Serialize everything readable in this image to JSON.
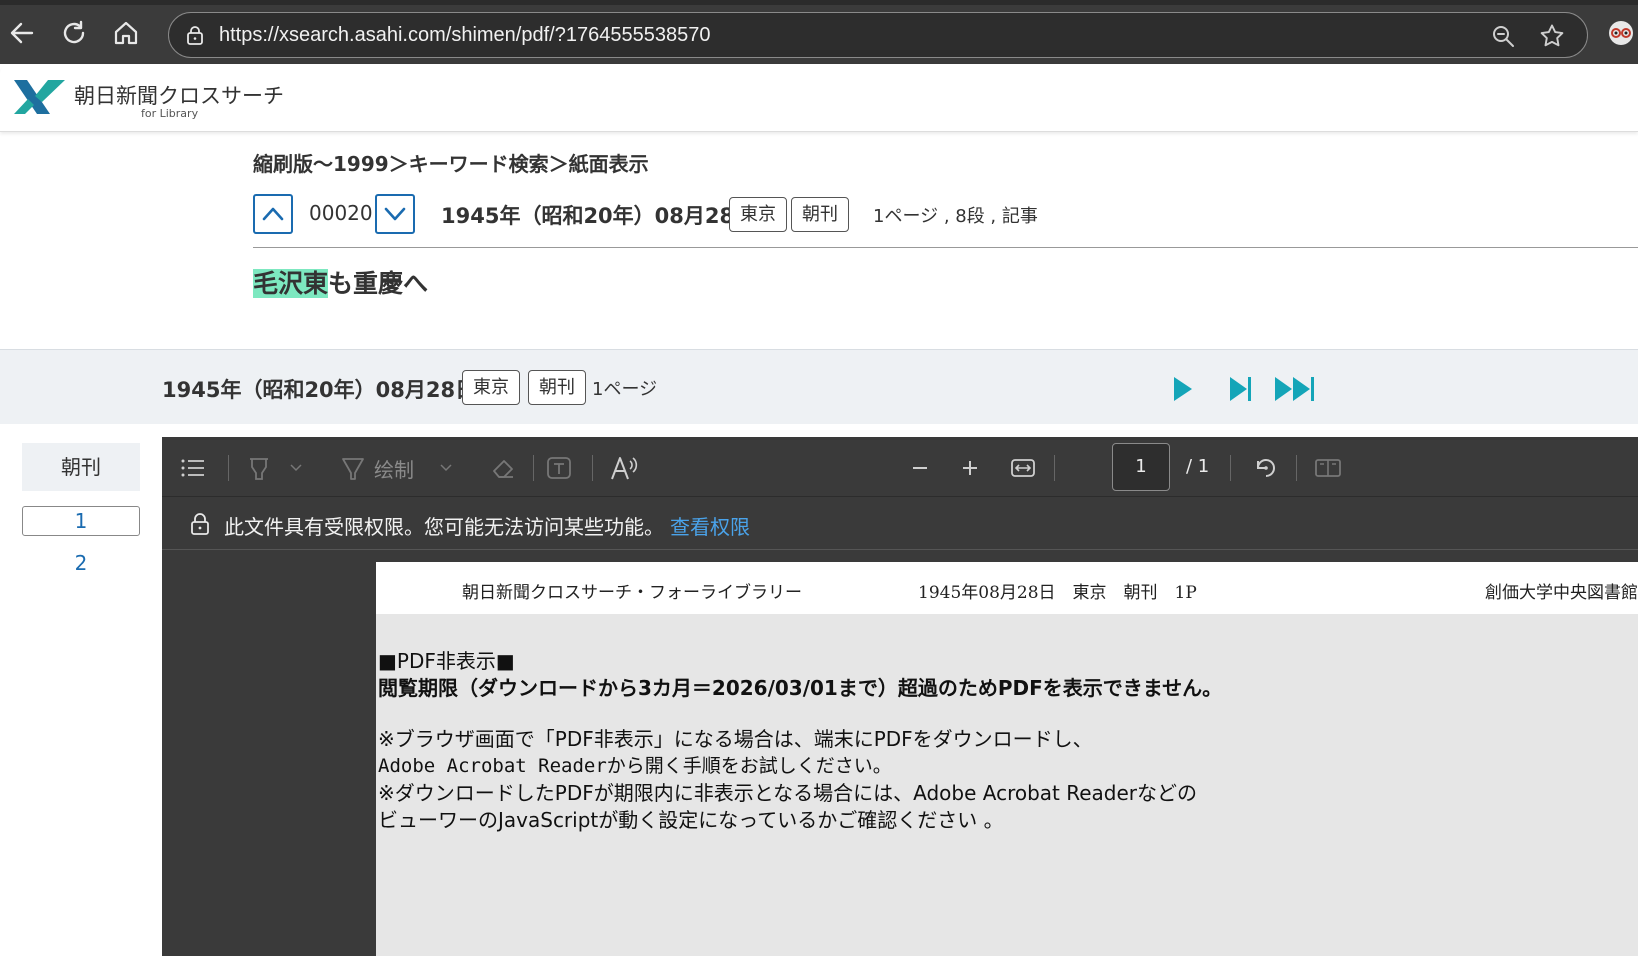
{
  "browser": {
    "url": "https://xsearch.asahi.com/shimen/pdf/?1764555538570"
  },
  "site": {
    "logo_text": "朝日新聞クロスサーチ",
    "logo_sub": "for Library"
  },
  "article": {
    "breadcrumb": "縮刷版〜1999＞キーワード検索＞紙面表示",
    "item_number": "00020",
    "issue_date": "1945年（昭和20年）08月28日",
    "edition_tag": "東京",
    "time_tag": "朝刊",
    "page_info": "1ページ , 8段 , 記事",
    "headline_highlight": "毛沢東",
    "headline_rest": "も重慶へ"
  },
  "viewer_bar": {
    "issue_date": "1945年（昭和20年）08月28日",
    "edition_tag": "東京",
    "time_tag": "朝刊",
    "pages": "1ページ"
  },
  "sidebar": {
    "title": "朝刊",
    "pages": [
      "1",
      "2"
    ],
    "active_page": "1"
  },
  "pdf_toolbar": {
    "draw_label": "绘制",
    "page_value": "1",
    "page_total": "/ 1"
  },
  "permission": {
    "message": "此文件具有受限权限。您可能无法访问某些功能。",
    "link": "查看权限"
  },
  "pdf_page": {
    "header_title": "朝日新聞クロスサーチ・フォーライブラリー",
    "header_issue": "1945年08月28日　東京　朝刊　1P",
    "header_library": "創価大学中央図書館",
    "line1": "■PDF非表示■",
    "line2": "閲覧期限（ダウンロードから3カ月＝2026/03/01まで）超過のためPDFを表示できません。",
    "line3": "※ブラウザ画面で「PDF非表示」になる場合は、端末にPDFをダウンロードし、",
    "line4": "Adobe Acrobat Readerから開く手順をお試しください。",
    "line5": "※ダウンロードしたPDFが期限内に非表示となる場合には、Adobe Acrobat Readerなどの",
    "line6": "ビューワーのJavaScriptが動く設定になっているかご確認ください 。"
  },
  "colors": {
    "accent_blue": "#1a6bb0",
    "play_teal": "#14a5b8",
    "highlight": "#7de8c0",
    "link_blue": "#4aa3ea"
  },
  "icons": [
    "back-icon",
    "refresh-icon",
    "home-icon",
    "lock-icon",
    "zoom-icon",
    "star-icon",
    "profile-icon",
    "chevron-up-icon",
    "chevron-down-icon",
    "play-icon",
    "skip-next-icon",
    "fast-forward-icon",
    "list-icon",
    "highlighter-icon",
    "draw-icon",
    "eraser-icon",
    "text-box-icon",
    "read-aloud-icon",
    "zoom-out-icon",
    "zoom-in-icon",
    "fit-width-icon",
    "rotate-icon",
    "page-view-icon"
  ]
}
